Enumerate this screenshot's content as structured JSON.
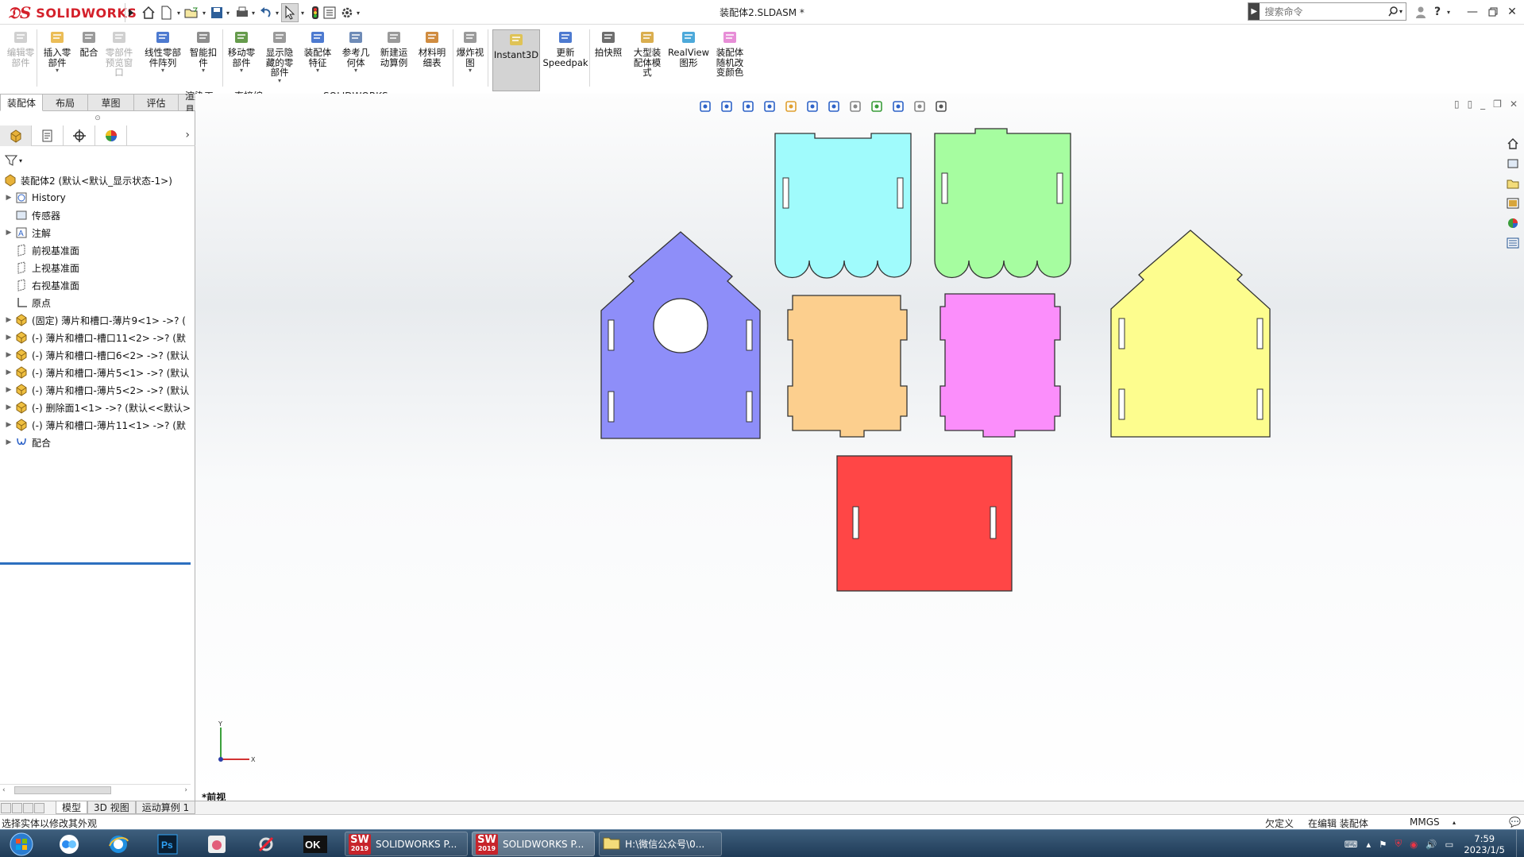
{
  "app": {
    "name": "SOLIDWORKS",
    "document_title": "装配体2.SLDASM *",
    "search_placeholder": "搜索命令"
  },
  "ribbon": {
    "buttons": [
      {
        "label": "编辑零\n部件",
        "icon": "edit-component-icon",
        "disabled": true
      },
      {
        "label": "插入零\n部件",
        "icon": "insert-component-icon"
      },
      {
        "label": "配合",
        "icon": "mate-icon"
      },
      {
        "label": "零部件\n预览窗\n口",
        "icon": "preview-window-icon",
        "disabled": true
      },
      {
        "label": "线性零部\n件阵列",
        "icon": "linear-pattern-icon"
      },
      {
        "label": "智能扣\n件",
        "icon": "smart-fastener-icon"
      },
      {
        "label": "移动零\n部件",
        "icon": "move-component-icon"
      },
      {
        "label": "显示隐\n藏的零\n部件",
        "icon": "show-hidden-icon"
      },
      {
        "label": "装配体\n特征",
        "icon": "assembly-feature-icon"
      },
      {
        "label": "参考几\n何体",
        "icon": "reference-geometry-icon"
      },
      {
        "label": "新建运\n动算例",
        "icon": "new-motion-study-icon"
      },
      {
        "label": "材料明\n细表",
        "icon": "bom-icon"
      },
      {
        "label": "爆炸视\n图",
        "icon": "exploded-view-icon"
      },
      {
        "label": "Instant3D",
        "icon": "instant3d-icon",
        "active": true
      },
      {
        "label": "更新\nSpeedpak",
        "icon": "speedpak-icon"
      },
      {
        "label": "拍快照",
        "icon": "snapshot-icon"
      },
      {
        "label": "大型装\n配体模\n式",
        "icon": "large-assembly-icon"
      },
      {
        "label": "RealView\n图形",
        "icon": "realview-icon"
      },
      {
        "label": "装配体\n随机改\n变颜色",
        "icon": "random-color-icon"
      }
    ]
  },
  "tabs": [
    "装配体",
    "布局",
    "草图",
    "评估",
    "渲染工具",
    "直接编辑",
    "MBD",
    "SOLIDWORKS 插件"
  ],
  "tree": {
    "root": "装配体2 (默认<默认_显示状态-1>)",
    "items": [
      {
        "label": "History",
        "icon": "history-icon",
        "expandable": true
      },
      {
        "label": "传感器",
        "icon": "sensor-icon",
        "expandable": false
      },
      {
        "label": "注解",
        "icon": "annotation-icon",
        "expandable": true
      },
      {
        "label": "前视基准面",
        "icon": "plane-icon",
        "expandable": false
      },
      {
        "label": "上视基准面",
        "icon": "plane-icon",
        "expandable": false
      },
      {
        "label": "右视基准面",
        "icon": "plane-icon",
        "expandable": false
      },
      {
        "label": "原点",
        "icon": "origin-icon",
        "expandable": false
      },
      {
        "label": "(固定) 薄片和槽口-薄片9<1> ->? (",
        "icon": "part-icon",
        "expandable": true
      },
      {
        "label": "(-) 薄片和槽口-槽口11<2> ->? (默",
        "icon": "part-icon",
        "expandable": true
      },
      {
        "label": "(-) 薄片和槽口-槽口6<2> ->? (默认",
        "icon": "part-icon",
        "expandable": true
      },
      {
        "label": "(-) 薄片和槽口-薄片5<1> ->? (默认",
        "icon": "part-icon",
        "expandable": true
      },
      {
        "label": "(-) 薄片和槽口-薄片5<2> ->? (默认",
        "icon": "part-icon",
        "expandable": true
      },
      {
        "label": "(-) 删除面1<1> ->? (默认<<默认>",
        "icon": "part-icon",
        "expandable": true
      },
      {
        "label": "(-) 薄片和槽口-薄片11<1> ->? (默",
        "icon": "part-icon",
        "expandable": true
      },
      {
        "label": "配合",
        "icon": "mates-folder-icon",
        "expandable": true
      }
    ]
  },
  "viewport": {
    "view_name": "*前视",
    "triad": {
      "y": "Y",
      "x": "X"
    },
    "parts_colors": {
      "cyan": "#a0fbfc",
      "green": "#a6fda0",
      "blue": "#8e8ef9",
      "orange": "#fccf8e",
      "magenta": "#fb8efb",
      "yellow": "#fdfd8e",
      "red": "#ff4646"
    }
  },
  "bottom_tabs": [
    "模型",
    "3D 视图",
    "运动算例 1"
  ],
  "status": {
    "message": "选择实体以修改其外观",
    "define": "欠定义",
    "editing": "在编辑 装配体",
    "units": "MMGS"
  },
  "taskbar": {
    "windows": [
      {
        "label": "SOLIDWORKS P...",
        "badge": "SW",
        "year": "2019",
        "active": false
      },
      {
        "label": "SOLIDWORKS P...",
        "badge": "SW",
        "year": "2019",
        "active": true
      },
      {
        "label": "H:\\微信公众号\\0...",
        "badge": "folder",
        "active": false
      }
    ],
    "time": "7:59",
    "date": "2023/1/5"
  }
}
